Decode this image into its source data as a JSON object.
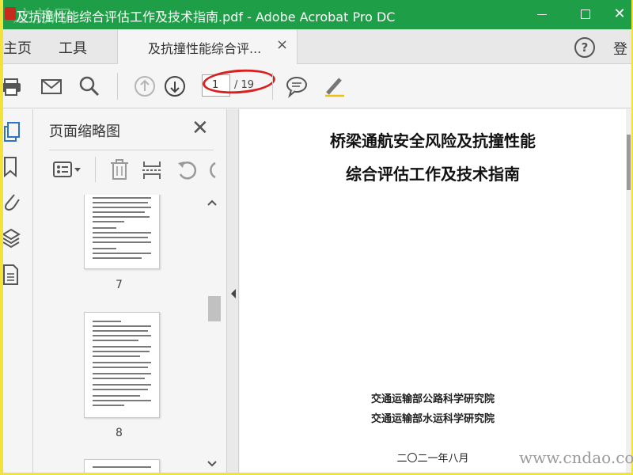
{
  "window": {
    "title": "及抗撞性能综合评估工作及技术指南.pdf - Adobe Acrobat Pro DC",
    "watermark": "之前网",
    "close_glyph": "✕"
  },
  "tabs": {
    "home": "主页",
    "tools": "工具",
    "document": "及抗撞性能综合评...",
    "close_glyph": "×",
    "help_glyph": "?",
    "login": "登"
  },
  "toolbar": {
    "current_page": "1",
    "total_pages": "/ 19"
  },
  "panel": {
    "title": "页面缩略图",
    "close_glyph": "✕",
    "thumbnails": [
      {
        "label": "7"
      },
      {
        "label": "8"
      }
    ]
  },
  "document": {
    "title_line1": "桥梁通航安全风险及抗撞性能",
    "title_line2": "综合评估工作及技术指南",
    "org1": "交通运输部公路科学研究院",
    "org2": "交通运输部水运科学研究院",
    "date": "二〇二一年八月"
  },
  "site_watermark": "www.cndao.com",
  "colors": {
    "titlebar": "#1f9e48",
    "annotation": "#d9201f",
    "outer_border": "#f2e33b"
  },
  "icons": [
    "print-icon",
    "mail-icon",
    "search-icon",
    "prev-page-icon",
    "next-page-icon",
    "comment-icon",
    "highlight-icon",
    "thumbnails-icon",
    "bookmark-icon",
    "attachment-icon",
    "layers-icon",
    "page-icon",
    "options-icon",
    "delete-icon",
    "extract-icon",
    "undo-icon"
  ]
}
